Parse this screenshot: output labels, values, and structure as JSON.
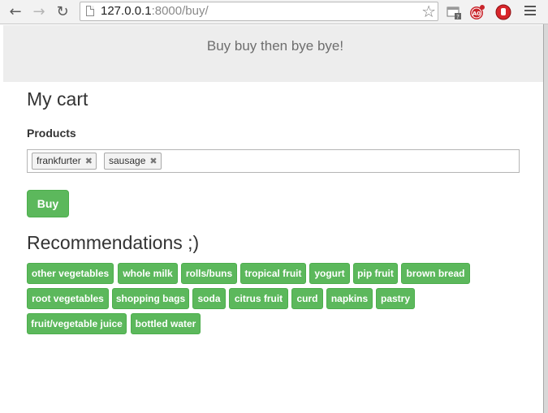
{
  "browser": {
    "url_host": "127.0.0.1",
    "url_rest": ":8000/buy/"
  },
  "banner": {
    "title": "Buy buy then bye bye!"
  },
  "cart": {
    "title": "My cart",
    "products_label": "Products",
    "tags": [
      "frankfurter",
      "sausage"
    ],
    "buy_label": "Buy"
  },
  "recommendations": {
    "title": "Recommendations ;)",
    "items": [
      "other vegetables",
      "whole milk",
      "rolls/buns",
      "tropical fruit",
      "yogurt",
      "pip fruit",
      "brown bread",
      "root vegetables",
      "shopping bags",
      "soda",
      "citrus fruit",
      "curd",
      "napkins",
      "pastry",
      "fruit/vegetable juice",
      "bottled water"
    ]
  },
  "colors": {
    "button_green": "#5cb85c",
    "banner_bg": "#ededed"
  }
}
